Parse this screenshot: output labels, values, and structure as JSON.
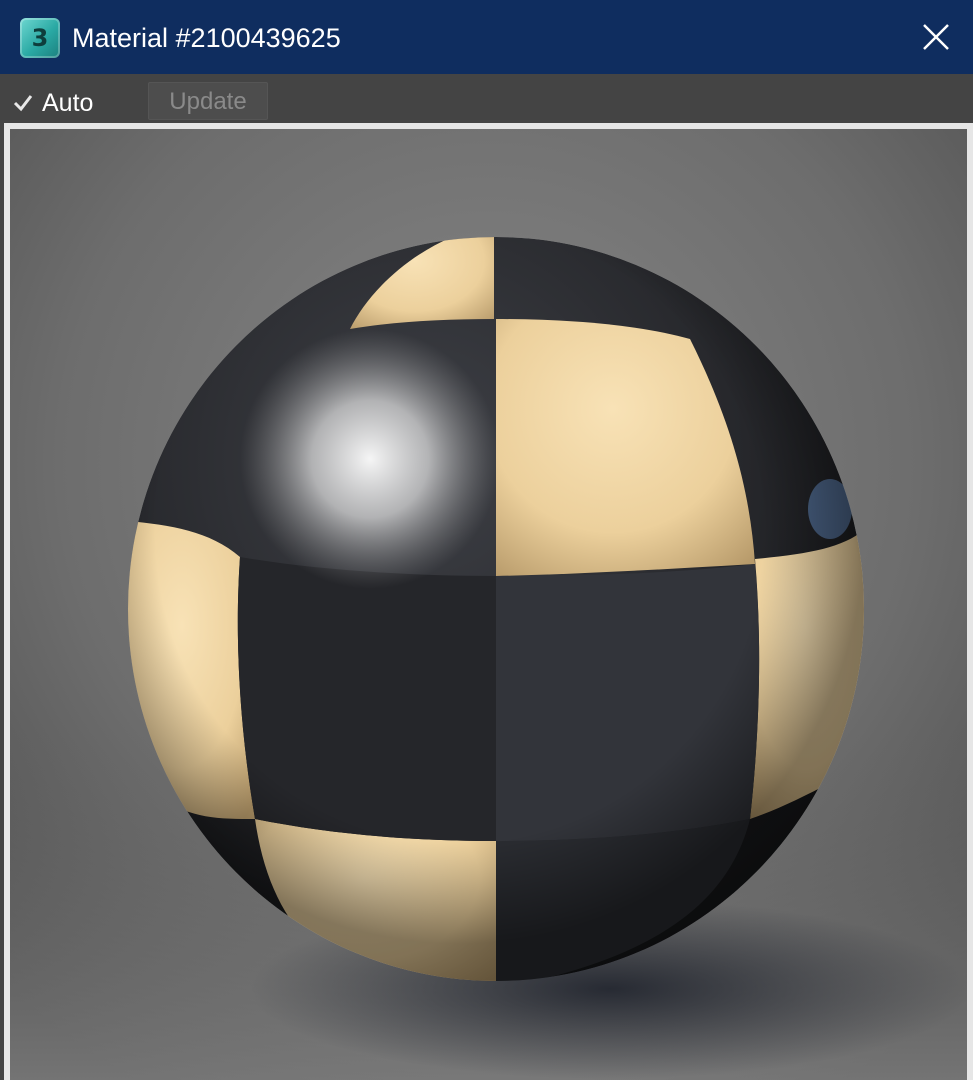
{
  "window": {
    "title": "Material #2100439625",
    "app_icon_glyph": "3",
    "app_icon_name": "3ds-max-app-icon",
    "close_icon": "close-icon"
  },
  "toolbar": {
    "auto_label": "Auto",
    "auto_checked": true,
    "update_label": "Update",
    "update_enabled": false
  },
  "preview": {
    "content": "rendered sphere with checker material",
    "checker_colors": [
      "#f1d7a8",
      "#1d1e21"
    ],
    "background_color": "#767676"
  },
  "colors": {
    "titlebar": "#0f2d5f",
    "toolbar": "#444444",
    "frame": "#e6e6e6"
  }
}
